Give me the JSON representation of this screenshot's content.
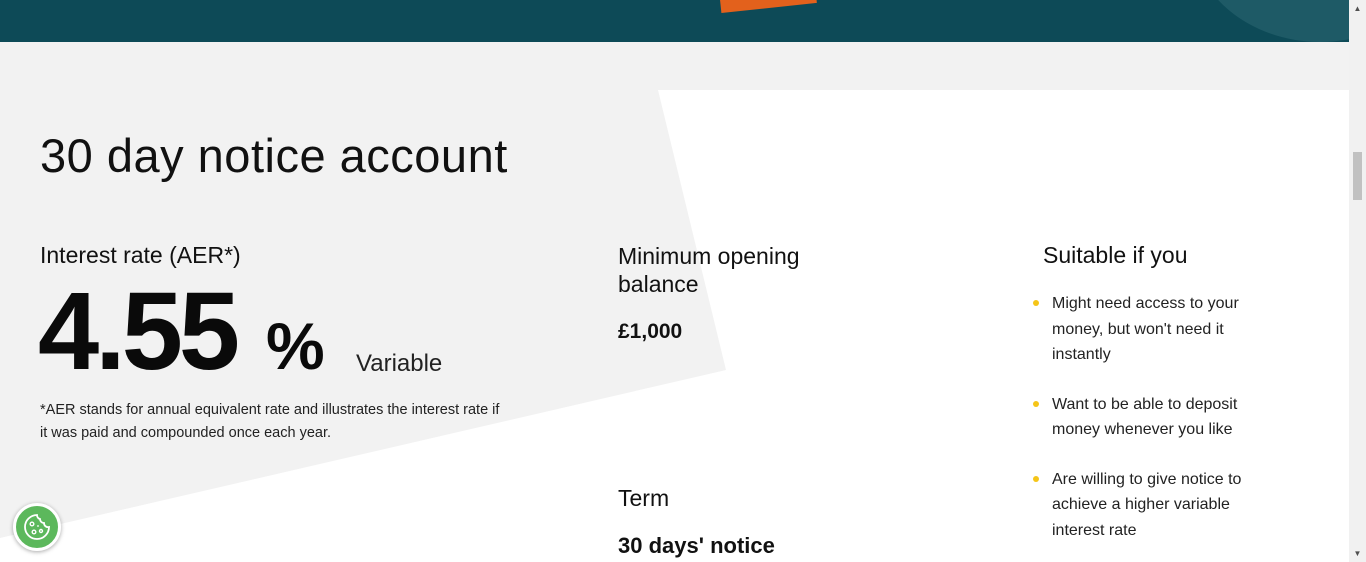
{
  "account": {
    "title": "30 day notice account",
    "interest": {
      "label": "Interest rate (AER*)",
      "value": "4.55",
      "percent": "%",
      "type": "Variable",
      "note": "*AER stands for annual equivalent rate and illustrates the interest rate if it was paid and compounded once each year."
    },
    "minimum": {
      "label": "Minimum opening balance",
      "value": "£1,000"
    },
    "term": {
      "label": "Term",
      "value": "30 days' notice"
    },
    "suitable": {
      "title": "Suitable if you",
      "items": [
        "Might need access to your money, but won't need it instantly",
        "Want to be able to deposit money whenever you like",
        "Are willing to give notice to achieve a higher variable interest rate"
      ]
    }
  },
  "icons": {
    "cookie": "cookie-icon",
    "scroll_up": "scroll-up-arrow",
    "scroll_down": "scroll-down-arrow"
  },
  "colors": {
    "banner": "#0d4a57",
    "bullet": "#f5c518",
    "cookie": "#5cb85c"
  }
}
